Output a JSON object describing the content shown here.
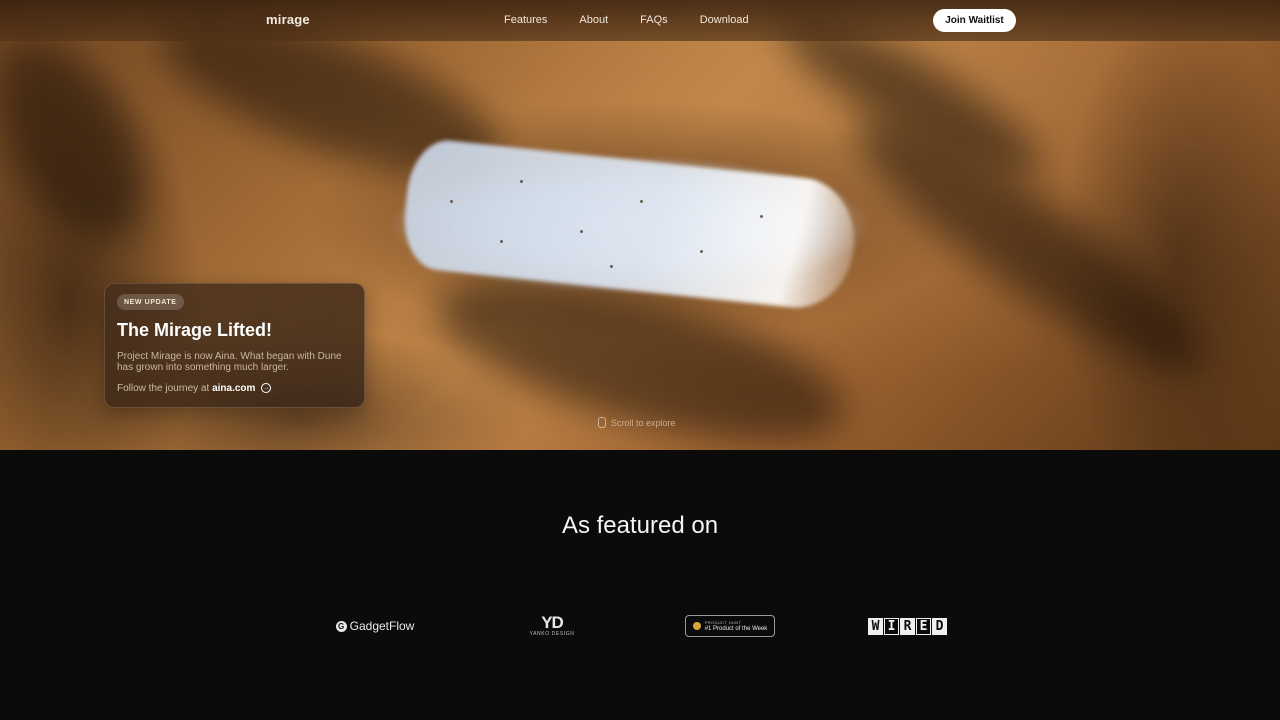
{
  "nav": {
    "logo": "mirage",
    "links": [
      "Features",
      "About",
      "FAQs",
      "Download"
    ],
    "cta_label": "Join Waitlist"
  },
  "announcement": {
    "badge": "NEW UPDATE",
    "title": "The Mirage Lifted!",
    "body": "Project Mirage is now Aina. What began with Dune has grown into something much larger.",
    "follow_prefix": "Follow the journey at",
    "follow_link": "aina.com"
  },
  "hero": {
    "scroll_hint": "Scroll to explore"
  },
  "featured": {
    "title": "As featured on",
    "logos": {
      "gadgetflow": {
        "icon_letter": "G",
        "name": "GadgetFlow"
      },
      "yanko": {
        "mark": "YD",
        "sub": "YANKO DESIGN"
      },
      "producthunt": {
        "top": "PRODUCT HUNT",
        "main": "#1 Product of the Week"
      },
      "wired": [
        "W",
        "I",
        "R",
        "E",
        "D"
      ]
    }
  },
  "colors": {
    "page_bg": "#0b0b0c",
    "cta_bg": "#ffffff",
    "accent_sand": "#c4884a"
  }
}
